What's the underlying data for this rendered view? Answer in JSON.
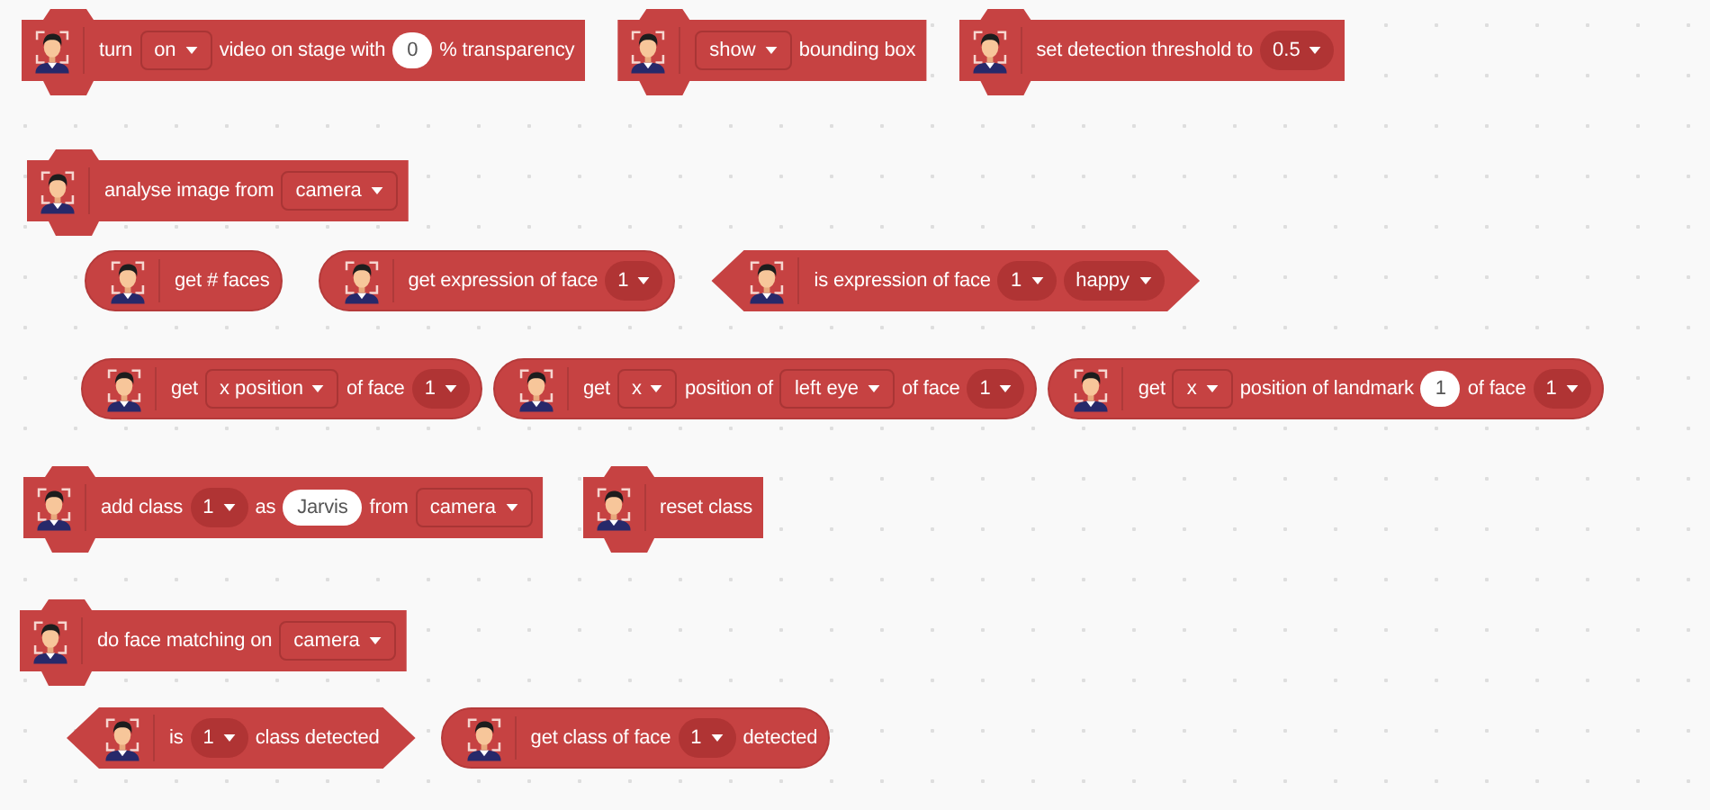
{
  "rows": [
    {
      "blocks": [
        {
          "kind": "stack",
          "parts": [
            {
              "kind": "label",
              "text": "turn"
            },
            {
              "kind": "menu",
              "text": "on"
            },
            {
              "kind": "label",
              "text": "video on stage with"
            },
            {
              "kind": "input",
              "text": "0"
            },
            {
              "kind": "label",
              "text": "% transparency"
            }
          ]
        },
        {
          "kind": "stack",
          "parts": [
            {
              "kind": "menu",
              "text": "show"
            },
            {
              "kind": "label",
              "text": "bounding box"
            }
          ]
        },
        {
          "kind": "stack",
          "parts": [
            {
              "kind": "label",
              "text": "set detection threshold to"
            },
            {
              "kind": "round_menu",
              "text": "0.5"
            }
          ]
        }
      ]
    },
    {
      "blocks": [
        {
          "kind": "stack",
          "parts": [
            {
              "kind": "label",
              "text": "analyse image from"
            },
            {
              "kind": "menu",
              "text": "camera"
            }
          ]
        }
      ]
    },
    {
      "blocks": [
        {
          "kind": "reporter",
          "parts": [
            {
              "kind": "label",
              "text": "get # faces"
            }
          ]
        },
        {
          "kind": "reporter",
          "parts": [
            {
              "kind": "label",
              "text": "get expression of face"
            },
            {
              "kind": "round_menu",
              "text": "1"
            }
          ]
        },
        {
          "kind": "boolean",
          "parts": [
            {
              "kind": "label",
              "text": "is expression of face"
            },
            {
              "kind": "round_menu",
              "text": "1"
            },
            {
              "kind": "round_menu",
              "text": "happy"
            }
          ]
        }
      ]
    },
    {
      "blocks": [
        {
          "kind": "reporter",
          "parts": [
            {
              "kind": "label",
              "text": "get"
            },
            {
              "kind": "menu",
              "text": "x position"
            },
            {
              "kind": "label",
              "text": "of face"
            },
            {
              "kind": "round_menu",
              "text": "1"
            }
          ]
        },
        {
          "kind": "reporter",
          "parts": [
            {
              "kind": "label",
              "text": "get"
            },
            {
              "kind": "menu",
              "text": "x"
            },
            {
              "kind": "label",
              "text": "position of"
            },
            {
              "kind": "menu",
              "text": "left eye"
            },
            {
              "kind": "label",
              "text": "of face"
            },
            {
              "kind": "round_menu",
              "text": "1"
            }
          ]
        },
        {
          "kind": "reporter",
          "parts": [
            {
              "kind": "label",
              "text": "get"
            },
            {
              "kind": "menu",
              "text": "x"
            },
            {
              "kind": "label",
              "text": "position of landmark"
            },
            {
              "kind": "input",
              "text": "1"
            },
            {
              "kind": "label",
              "text": "of face"
            },
            {
              "kind": "round_menu",
              "text": "1"
            }
          ]
        }
      ]
    },
    {
      "blocks": [
        {
          "kind": "stack",
          "parts": [
            {
              "kind": "label",
              "text": "add class"
            },
            {
              "kind": "round_menu",
              "text": "1"
            },
            {
              "kind": "label",
              "text": "as"
            },
            {
              "kind": "input",
              "text": "Jarvis"
            },
            {
              "kind": "label",
              "text": "from"
            },
            {
              "kind": "menu",
              "text": "camera"
            }
          ]
        },
        {
          "kind": "stack",
          "parts": [
            {
              "kind": "label",
              "text": "reset class"
            }
          ]
        }
      ]
    },
    {
      "blocks": [
        {
          "kind": "stack",
          "parts": [
            {
              "kind": "label",
              "text": "do face matching on"
            },
            {
              "kind": "menu",
              "text": "camera"
            }
          ]
        }
      ]
    },
    {
      "blocks": [
        {
          "kind": "boolean",
          "parts": [
            {
              "kind": "label",
              "text": "is"
            },
            {
              "kind": "round_menu",
              "text": "1"
            },
            {
              "kind": "label",
              "text": "class detected"
            }
          ]
        },
        {
          "kind": "reporter",
          "parts": [
            {
              "kind": "label",
              "text": "get class of face"
            },
            {
              "kind": "round_menu",
              "text": "1"
            },
            {
              "kind": "label",
              "text": "detected"
            }
          ]
        }
      ]
    }
  ]
}
